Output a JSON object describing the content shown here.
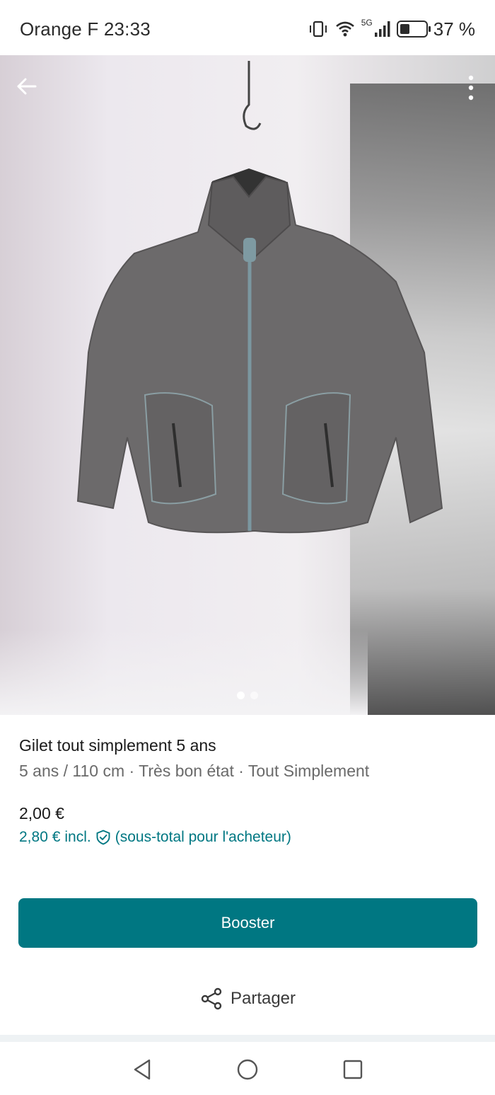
{
  "status_bar": {
    "carrier_time": "Orange F 23:33",
    "network": "5G",
    "battery_percent": "37 %",
    "battery_level": 0.37
  },
  "photo": {
    "page_indicator": {
      "count": 2,
      "active_index": 0
    },
    "icons": {
      "back": "arrow-left-icon",
      "more": "more-vertical-icon"
    }
  },
  "listing": {
    "title": "Gilet tout simplement 5 ans",
    "subtitle": "5 ans / 110 cm · Très bon état · Tout Simplement",
    "price": "2,00 €",
    "buyer_price": "2,80 €",
    "buyer_incl": "incl.",
    "buyer_note": "(sous-total pour l'acheteur)"
  },
  "actions": {
    "booster_label": "Booster",
    "share_label": "Partager"
  },
  "colors": {
    "accent": "#007782",
    "text": "#1a1a1a",
    "muted": "#6a6a6a"
  },
  "nav": {
    "icons": [
      "nav-back-icon",
      "nav-home-icon",
      "nav-recent-apps-icon"
    ]
  }
}
